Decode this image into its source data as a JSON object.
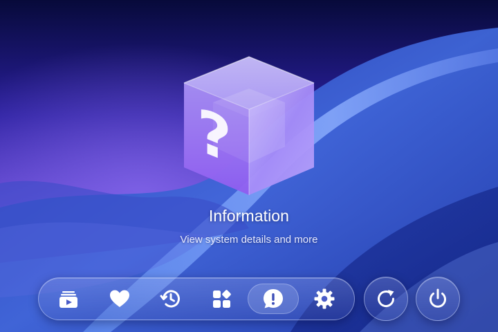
{
  "hero": {
    "title": "Information",
    "subtitle": "View system details and more",
    "icon": "question-cube-icon"
  },
  "dock": {
    "items": [
      {
        "name": "media-library",
        "icon": "play-stack-icon",
        "selected": false
      },
      {
        "name": "favorites",
        "icon": "heart-icon",
        "selected": false
      },
      {
        "name": "history",
        "icon": "clock-history-icon",
        "selected": false
      },
      {
        "name": "apps",
        "icon": "apps-grid-icon",
        "selected": false
      },
      {
        "name": "information",
        "icon": "exclamation-bubble-icon",
        "selected": true
      },
      {
        "name": "settings",
        "icon": "gear-icon",
        "selected": false
      }
    ]
  },
  "system_buttons": [
    {
      "name": "restart",
      "icon": "restart-icon"
    },
    {
      "name": "power",
      "icon": "power-icon"
    }
  ],
  "colors": {
    "background_dark": "#0a0f3f",
    "background_accent": "#6a4ed8",
    "wave_blue": "#2f5fd6",
    "icon_white": "#ffffff",
    "cube_purple": "#9b7cf2"
  }
}
